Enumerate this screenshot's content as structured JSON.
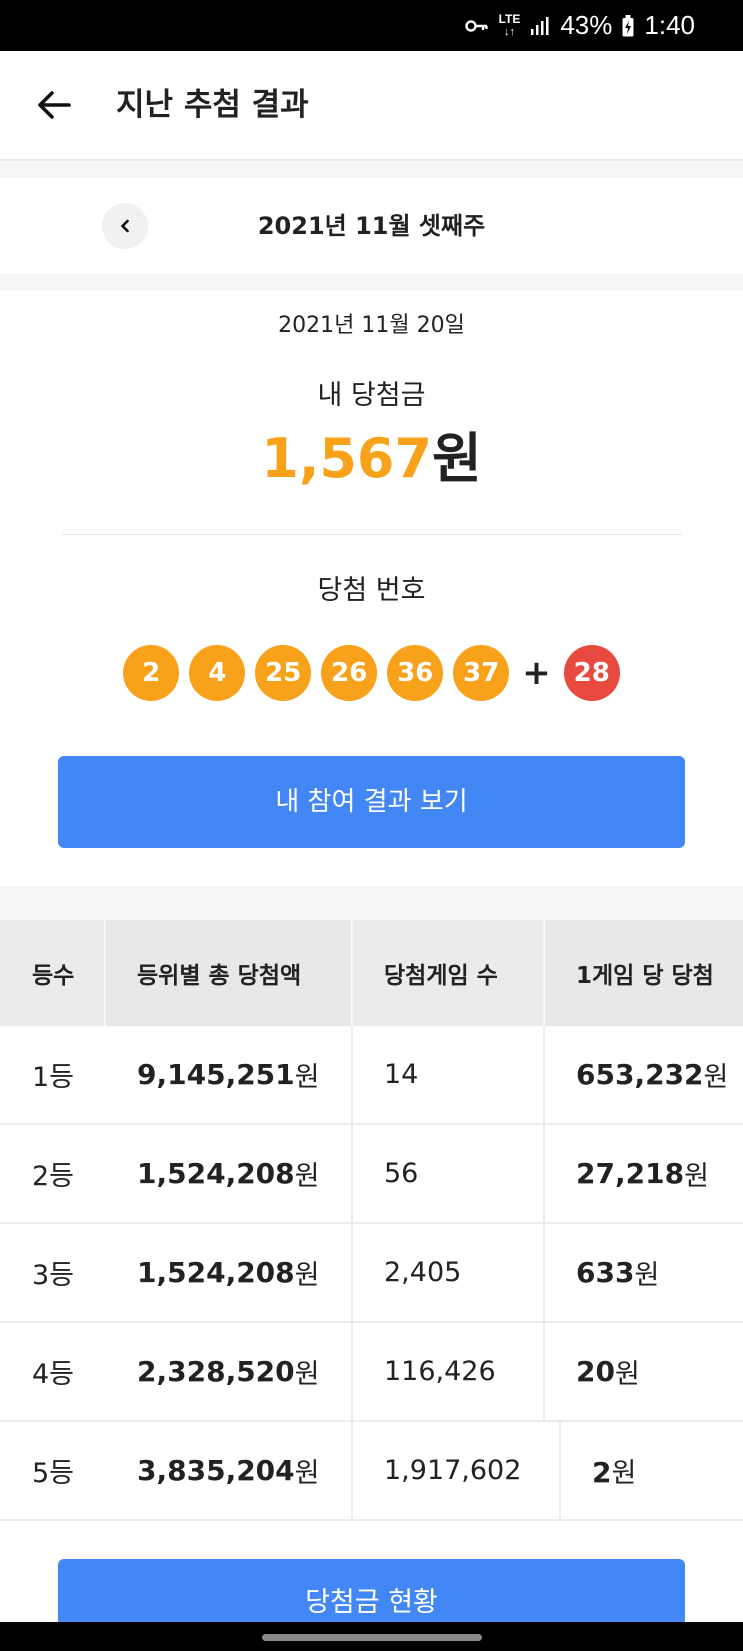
{
  "status_bar": {
    "network": "LTE",
    "battery": "43%",
    "time": "1:40"
  },
  "header": {
    "title": "지난 추첨 결과"
  },
  "week": {
    "label": "2021년 11월 셋째주"
  },
  "result": {
    "draw_date": "2021년 11월 20일",
    "prize_label": "내 당첨금",
    "prize_amount": "1,567",
    "prize_unit": "원",
    "numbers_label": "당첨 번호",
    "numbers": [
      "2",
      "4",
      "25",
      "26",
      "36",
      "37"
    ],
    "plus": "+",
    "bonus": "28",
    "my_result_button": "내 참여 결과 보기"
  },
  "table": {
    "headers": [
      "등수",
      "등위별 총 당첨액",
      "당첨게임 수",
      "1게임 당 당첨"
    ],
    "rows": [
      {
        "rank": "1등",
        "total": "9,145,251",
        "games": "14",
        "per_game": "653,232"
      },
      {
        "rank": "2등",
        "total": "1,524,208",
        "games": "56",
        "per_game": "27,218"
      },
      {
        "rank": "3등",
        "total": "1,524,208",
        "games": "2,405",
        "per_game": "633"
      },
      {
        "rank": "4등",
        "total": "2,328,520",
        "games": "116,426",
        "per_game": "20"
      },
      {
        "rank": "5등",
        "total": "3,835,204",
        "games": "1,917,602",
        "per_game": "2"
      }
    ],
    "unit": "원"
  },
  "bottom": {
    "status_button": "당첨금 현황"
  },
  "colors": {
    "accent": "#4287f5",
    "ball": "#f8a21b",
    "bonus_ball": "#e94a3f",
    "prize": "#f8a21b"
  }
}
